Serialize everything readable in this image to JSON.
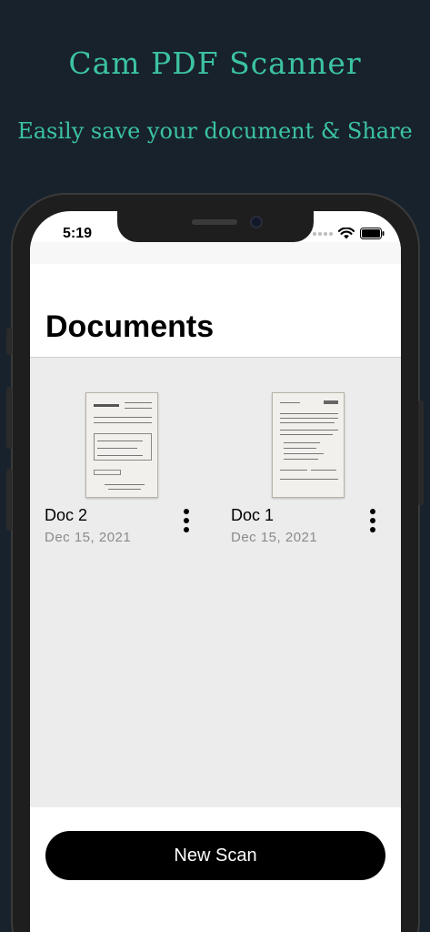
{
  "promo": {
    "title": "Cam PDF Scanner",
    "subtitle": "Easily save your document & Share"
  },
  "status_bar": {
    "time": "5:19"
  },
  "page": {
    "title": "Documents"
  },
  "documents": [
    {
      "name": "Doc 2",
      "date": "Dec 15, 2021"
    },
    {
      "name": "Doc 1",
      "date": "Dec 15, 2021"
    }
  ],
  "actions": {
    "new_scan_label": "New Scan"
  },
  "colors": {
    "background": "#17222d",
    "accent": "#3cc3a0",
    "doc_area": "#ececec",
    "button": "#000000"
  },
  "icons": [
    "wifi-icon",
    "battery-icon",
    "more-vertical-icon"
  ]
}
